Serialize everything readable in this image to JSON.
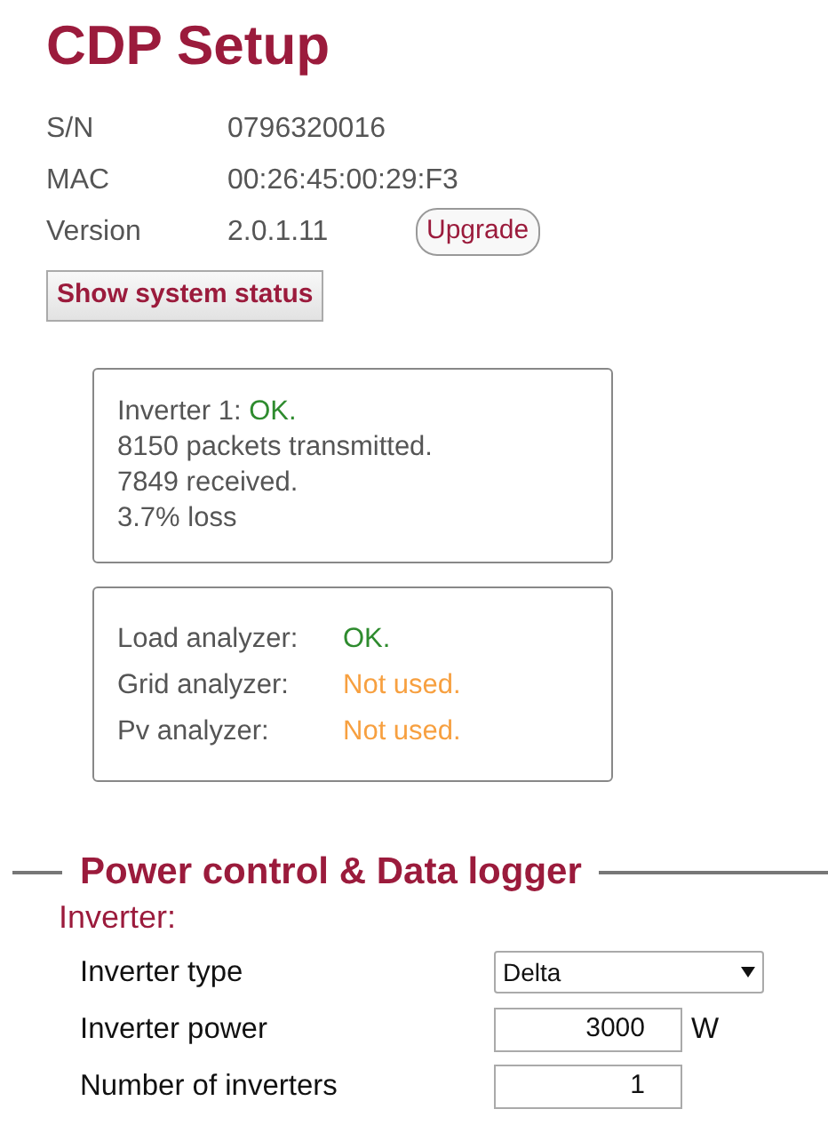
{
  "title": "CDP Setup",
  "info": [
    {
      "label": "S/N",
      "value": "0796320016"
    },
    {
      "label": "MAC",
      "value": "00:26:45:00:29:F3"
    },
    {
      "label": "Version",
      "value": "2.0.1.11",
      "button": "Upgrade"
    }
  ],
  "status_button": "Show system status",
  "inverter_status": {
    "label": "Inverter 1:",
    "status": "OK.",
    "color": "#2e8b2e",
    "lines": [
      "8150 packets transmitted.",
      "7849 received.",
      "3.7% loss"
    ]
  },
  "analyzers": [
    {
      "label": "Load analyzer:",
      "status": "OK.",
      "color": "#2e8b2e"
    },
    {
      "label": "Grid analyzer:",
      "status": "Not used.",
      "color": "#f7a040"
    },
    {
      "label": "Pv analyzer:",
      "status": "Not used.",
      "color": "#f7a040"
    }
  ],
  "section": {
    "title": "Power control & Data logger",
    "subtitle": "Inverter:"
  },
  "fields": [
    {
      "kind": "select",
      "label": "Inverter type",
      "value": "Delta"
    },
    {
      "kind": "number",
      "label": "Inverter power",
      "value": "3000",
      "unit": "W"
    },
    {
      "kind": "number",
      "label": "Number of inverters",
      "value": "1"
    }
  ]
}
